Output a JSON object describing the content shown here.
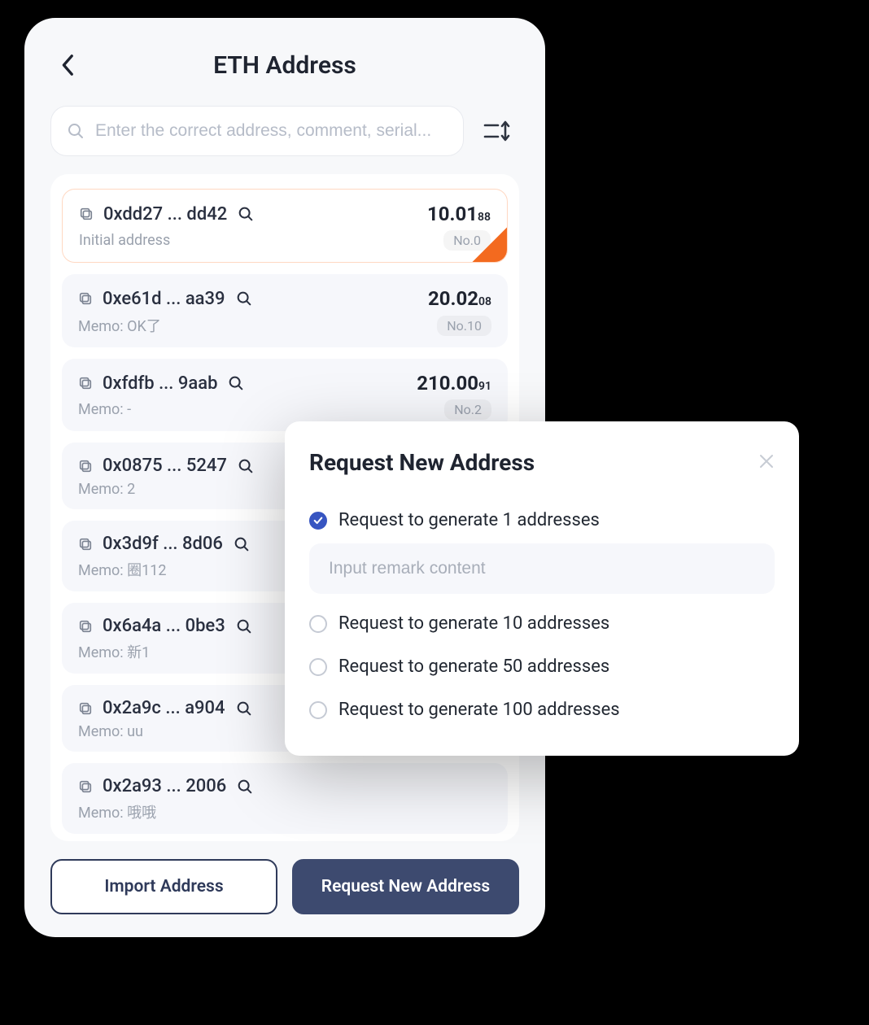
{
  "header": {
    "title": "ETH Address"
  },
  "search": {
    "placeholder": "Enter the correct address, comment, serial..."
  },
  "addresses": [
    {
      "addr": "0xdd27 ... dd42",
      "balance_main": "10.01",
      "balance_sub": "88",
      "memo": "Initial address",
      "badge": "No.0",
      "selected": true
    },
    {
      "addr": "0xe61d ... aa39",
      "balance_main": "20.02",
      "balance_sub": "08",
      "memo": "Memo: OK了",
      "badge": "No.10",
      "selected": false
    },
    {
      "addr": "0xfdfb ... 9aab",
      "balance_main": "210.00",
      "balance_sub": "91",
      "memo": "Memo: -",
      "badge": "No.2",
      "selected": false
    },
    {
      "addr": "0x0875 ... 5247",
      "balance_main": "",
      "balance_sub": "",
      "memo": "Memo: 2",
      "badge": "",
      "selected": false
    },
    {
      "addr": "0x3d9f ... 8d06",
      "balance_main": "",
      "balance_sub": "",
      "memo": "Memo: 圈112",
      "badge": "",
      "selected": false
    },
    {
      "addr": "0x6a4a ... 0be3",
      "balance_main": "",
      "balance_sub": "",
      "memo": "Memo: 新1",
      "badge": "",
      "selected": false
    },
    {
      "addr": "0x2a9c ... a904",
      "balance_main": "",
      "balance_sub": "",
      "memo": "Memo: uu",
      "badge": "",
      "selected": false
    },
    {
      "addr": "0x2a93 ... 2006",
      "balance_main": "",
      "balance_sub": "",
      "memo": "Memo: 哦哦",
      "badge": "",
      "selected": false
    }
  ],
  "footer": {
    "import_label": "Import Address",
    "request_label": "Request New Address"
  },
  "modal": {
    "title": "Request New Address",
    "options": [
      {
        "label": "Request to generate 1 addresses",
        "selected": true
      },
      {
        "label": "Request to generate 10 addresses",
        "selected": false
      },
      {
        "label": "Request to generate 50 addresses",
        "selected": false
      },
      {
        "label": "Request to generate 100 addresses",
        "selected": false
      }
    ],
    "remark_placeholder": "Input remark content"
  }
}
